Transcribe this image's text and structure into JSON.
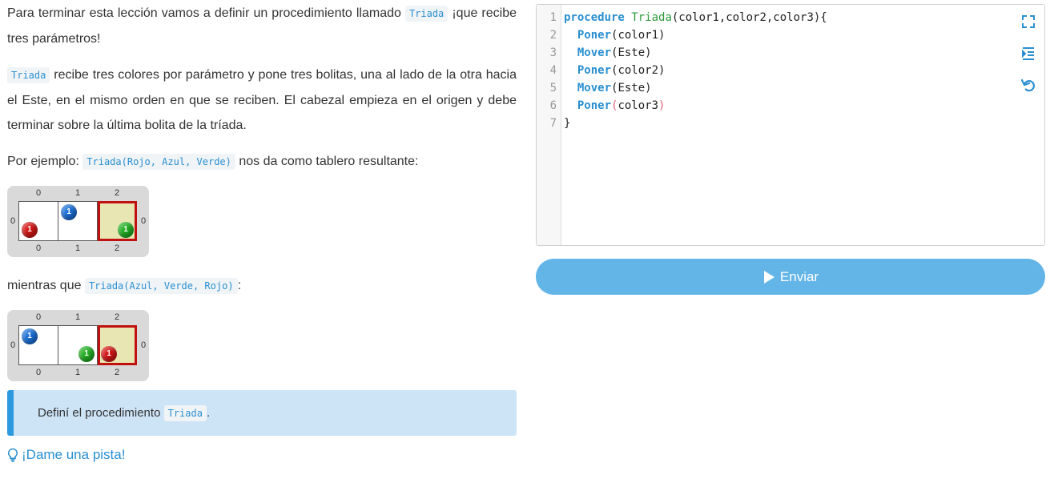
{
  "lesson": {
    "p1_before": "Para terminar esta lección vamos a definir un procedimiento llamado ",
    "p1_code": "Triada",
    "p1_after": " ¡que recibe tres parámetros!",
    "p2_code": "Triada",
    "p2_after": " recibe tres colores por parámetro y pone tres bolitas, una al lado de la otra hacia el Este, en el mismo orden en que se reciben. El cabezal empieza en el origen y debe terminar sobre la última bolita de la tríada.",
    "p3_before": "Por ejemplo: ",
    "p3_code": "Triada(Rojo, Azul, Verde)",
    "p3_after": " nos da como tablero resultante:",
    "p4_before": "mientras que ",
    "p4_code": "Triada(Azul, Verde, Rojo)",
    "p4_after": ":"
  },
  "board_labels": {
    "c0": "0",
    "c1": "1",
    "c2": "2",
    "r0": "0"
  },
  "board1": {
    "cell0": "1",
    "cell1": "1",
    "cell2": "1"
  },
  "board2": {
    "cell0": "1",
    "cell1": "1",
    "cell2": "1"
  },
  "hint": {
    "before": "Definí el procedimiento ",
    "code": "Triada",
    "after": "."
  },
  "pista_label": "¡Dame una pista!",
  "editor": {
    "line_numbers": [
      "1",
      "2",
      "3",
      "4",
      "5",
      "6",
      "7"
    ],
    "l1_kw": "procedure",
    "l1_fn": "Triada",
    "l1_rest": "(color1,color2,color3){",
    "l2_kw": "Poner",
    "l2_rest": "(color1)",
    "l3_kw": "Mover",
    "l3_rest": "(Este)",
    "l4_kw": "Poner",
    "l4_rest": "(color2)",
    "l5_kw": "Mover",
    "l5_rest": "(Este)",
    "l6_kw": "Poner",
    "l6_p1": "(",
    "l6_arg": "color3",
    "l6_p2": ")",
    "l7": "}"
  },
  "submit_label": "Enviar",
  "colors": {
    "accent": "#2a8fd0",
    "button": "#63b5e8",
    "hint_bg": "#cde3f6",
    "red": "#d41616",
    "blue": "#1b70d8",
    "green": "#22b022"
  }
}
